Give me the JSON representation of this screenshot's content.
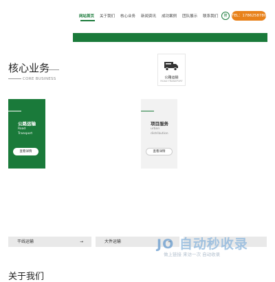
{
  "nav": {
    "items": [
      "网站首页",
      "关于我们",
      "核心业务",
      "新闻资讯",
      "成功案例",
      "团队展示",
      "联系我们"
    ],
    "active_index": 0,
    "search_label": "搜",
    "tel": "TEL：17862587800"
  },
  "section": {
    "title": "核心业务",
    "subtitle": "CORE BUSINESS"
  },
  "truck_card": {
    "label": "公路运输",
    "label_en": "ROAD TRANSPORT"
  },
  "cards": [
    {
      "title": "公路运输",
      "sub1": "Road",
      "sub2": "Transport",
      "button": "查看详情"
    },
    {
      "title": "项目服务",
      "sub1": "urban",
      "sub2": "distribution",
      "button": "查看详情"
    }
  ],
  "bars": [
    {
      "label": "干线运输",
      "arrow": "→"
    },
    {
      "label": "大件运输",
      "arrow": "→"
    }
  ],
  "about": {
    "title": "关于我们"
  },
  "watermark": {
    "logo": "自动秒收录",
    "sub": "做上链接 来访一次 自动收录"
  },
  "colors": {
    "brand": "#1a7a3a",
    "accent": "#e8811a"
  }
}
